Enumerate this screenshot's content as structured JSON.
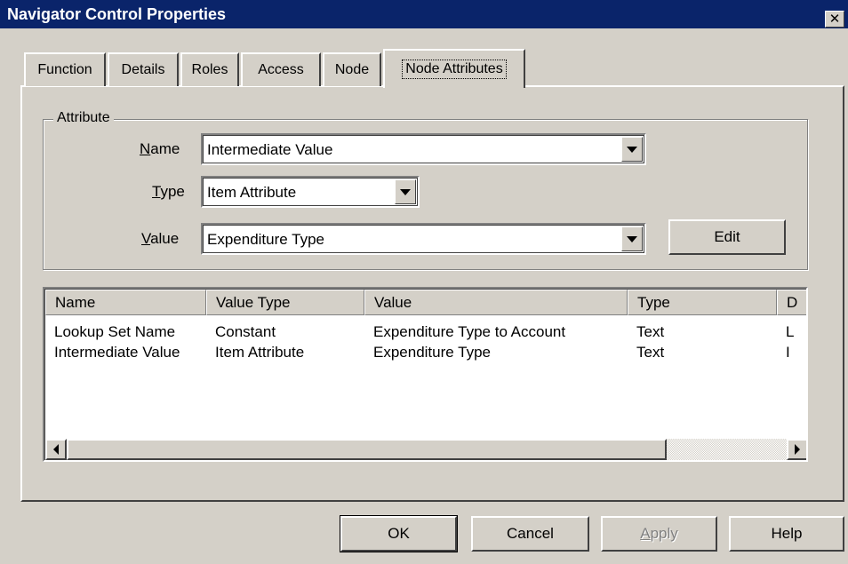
{
  "window": {
    "title": "Navigator Control Properties",
    "close_glyph": "✕"
  },
  "tabs": [
    {
      "label": "Function",
      "active": false
    },
    {
      "label": "Details",
      "active": false
    },
    {
      "label": "Roles",
      "active": false
    },
    {
      "label": "Access",
      "active": false
    },
    {
      "label": "Node",
      "active": false
    },
    {
      "label": "Node Attributes",
      "active": true
    }
  ],
  "attribute": {
    "legend": "Attribute",
    "name": {
      "label_hotkey": "N",
      "label_rest": "ame",
      "value": "Intermediate Value"
    },
    "type": {
      "label_hotkey": "T",
      "label_rest": "ype",
      "value": "Item Attribute"
    },
    "value": {
      "label_hotkey": "V",
      "label_rest": "alue",
      "value": "Expenditure Type"
    },
    "edit_label": "Edit"
  },
  "table": {
    "columns": [
      "Name",
      "Value Type",
      "Value",
      "Type",
      "D"
    ],
    "rows": [
      [
        "Lookup Set Name",
        "Constant",
        "Expenditure Type to Account",
        "Text",
        "L"
      ],
      [
        "Intermediate Value",
        "Item Attribute",
        "Expenditure Type",
        "Text",
        "I"
      ]
    ]
  },
  "footer": {
    "ok_label": "OK",
    "cancel_label": "Cancel",
    "apply_hotkey": "A",
    "apply_rest": "pply",
    "help_label": "Help"
  },
  "colors": {
    "titlebar": "#0a246a",
    "face": "#d4d0c8",
    "window": "#ffffff"
  }
}
